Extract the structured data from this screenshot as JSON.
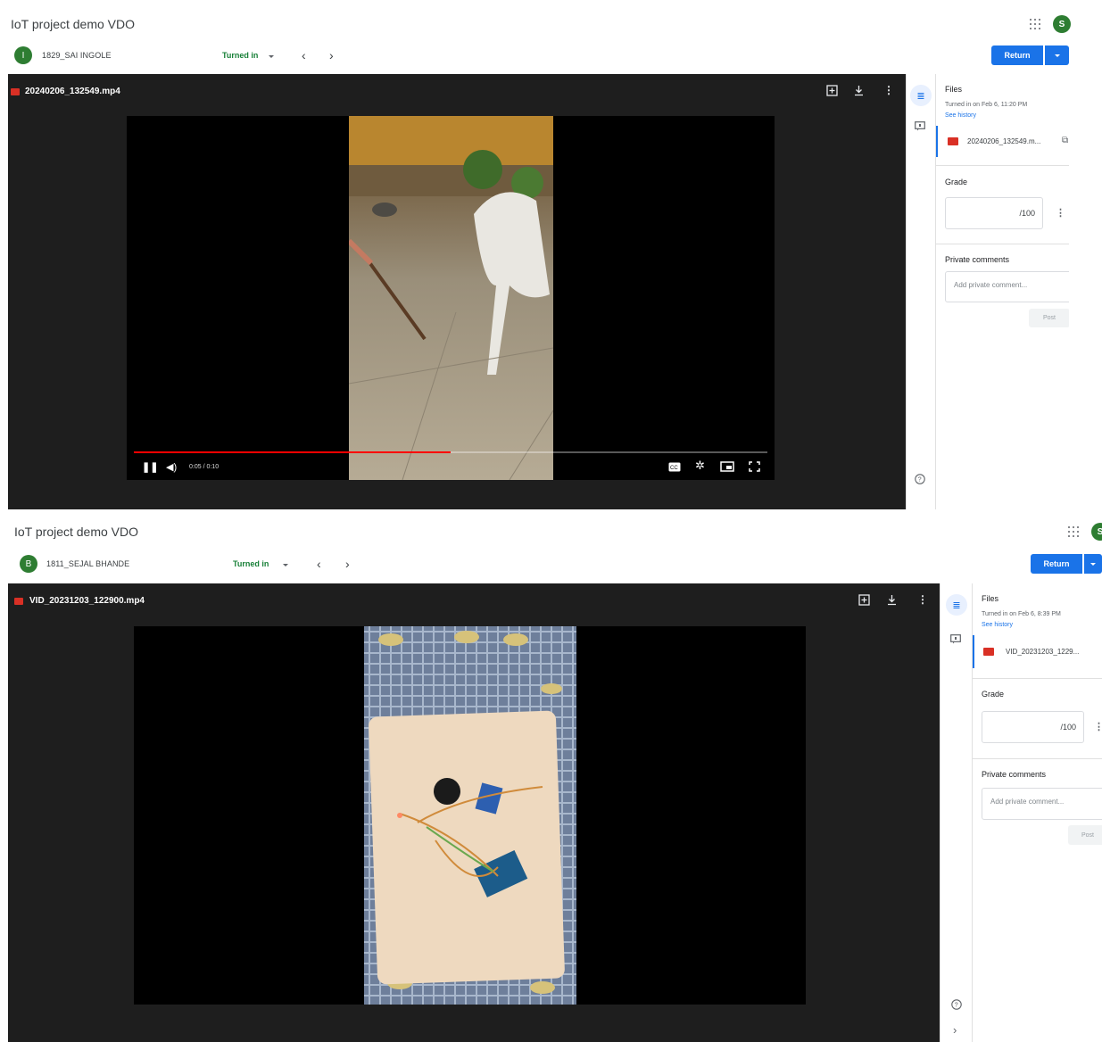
{
  "screen1": {
    "title": "IoT project demo VDO",
    "account_initial": "S",
    "student": {
      "initial": "I",
      "name": "1829_SAI INGOLE",
      "status": "Turned in"
    },
    "return_label": "Return",
    "file_title": "20240206_132549.mp4",
    "player": {
      "time": "0:05 / 0:10",
      "progress": 0.5
    },
    "files": {
      "heading": "Files",
      "turned_in": "Turned in on Feb 6, 11:20 PM",
      "history": "See history",
      "file_name": "20240206_132549.m..."
    },
    "grade": {
      "heading": "Grade",
      "value": "/100"
    },
    "comments": {
      "heading": "Private comments",
      "placeholder": "Add private comment...",
      "post": "Post"
    }
  },
  "screen2": {
    "title": "IoT project demo VDO",
    "account_initial": "S",
    "student": {
      "initial": "B",
      "name": "1811_SEJAL BHANDE",
      "status": "Turned in"
    },
    "return_label": "Return",
    "file_title": "VID_20231203_122900.mp4",
    "files": {
      "heading": "Files",
      "turned_in": "Turned in on Feb 6, 8:39 PM",
      "history": "See history",
      "file_name": "VID_20231203_1229..."
    },
    "grade": {
      "heading": "Grade",
      "value": "/100"
    },
    "comments": {
      "heading": "Private comments",
      "placeholder": "Add private comment...",
      "post": "Post"
    }
  },
  "icons": [
    "apps-grid-icon",
    "account-avatar",
    "chevron-left-icon",
    "chevron-right-icon",
    "add-to-drive-icon",
    "download-icon",
    "more-vert-icon",
    "details-icon",
    "comment-icon",
    "help-icon",
    "video-file-icon",
    "open-in-new-icon",
    "pause-icon",
    "volume-icon",
    "captions-icon",
    "settings-icon",
    "miniplayer-icon",
    "fullscreen-icon"
  ],
  "colors": {
    "accent": "#1a73e8",
    "status_green": "#188038",
    "avatar_green": "#2e7d32",
    "file_red": "#d93025",
    "viewer_bg": "#1e1e1e"
  }
}
